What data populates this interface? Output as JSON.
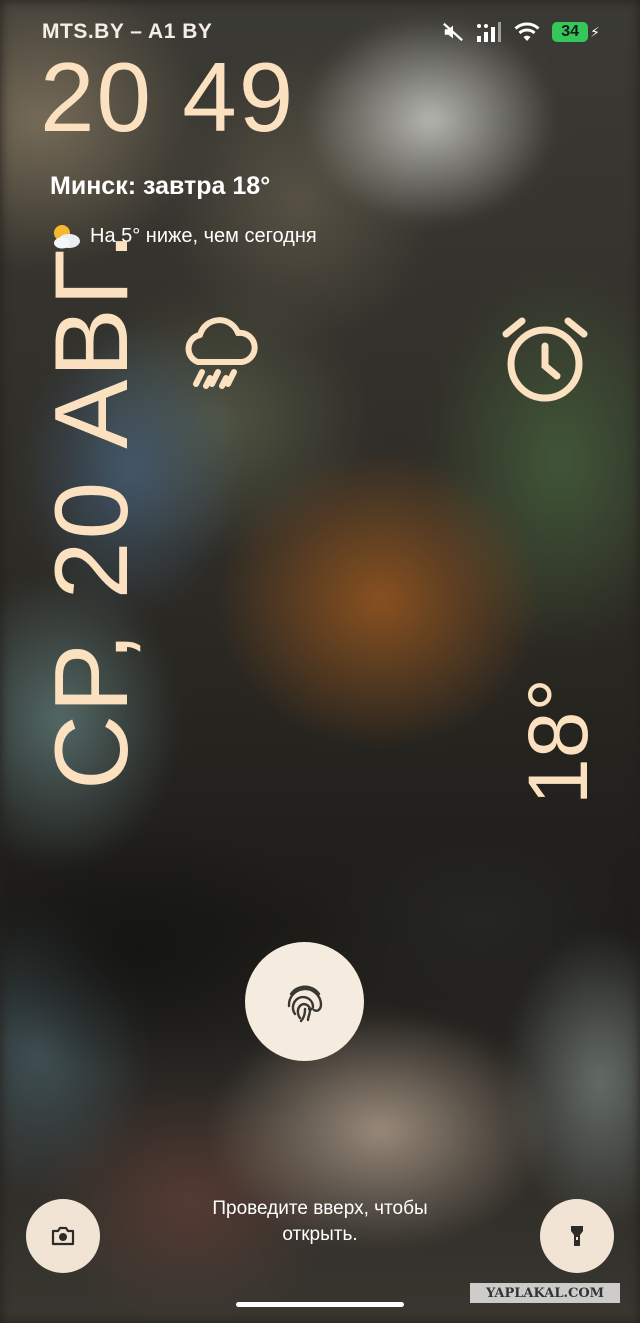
{
  "status_bar": {
    "carrier": "MTS.BY – A1 BY",
    "battery_level": "34",
    "icons": [
      "mute-icon",
      "signal-icon",
      "wifi-icon",
      "battery-icon",
      "charging-icon"
    ]
  },
  "lockscreen": {
    "time": "20 49",
    "weather_forecast": "Минск: завтра 18°",
    "weather_compare": "На 5° ниже, чем сегодня",
    "date": "СР, 20 АВГ.",
    "temperature": "18°",
    "swipe_hint_line1": "Проведите вверх, чтобы",
    "swipe_hint_line2": "открыть."
  },
  "watermark": "YAPLAKAL.COM",
  "colors": {
    "clock": "#fbe1bf",
    "button_bg": "#f1e4d5",
    "battery": "#34c759"
  }
}
